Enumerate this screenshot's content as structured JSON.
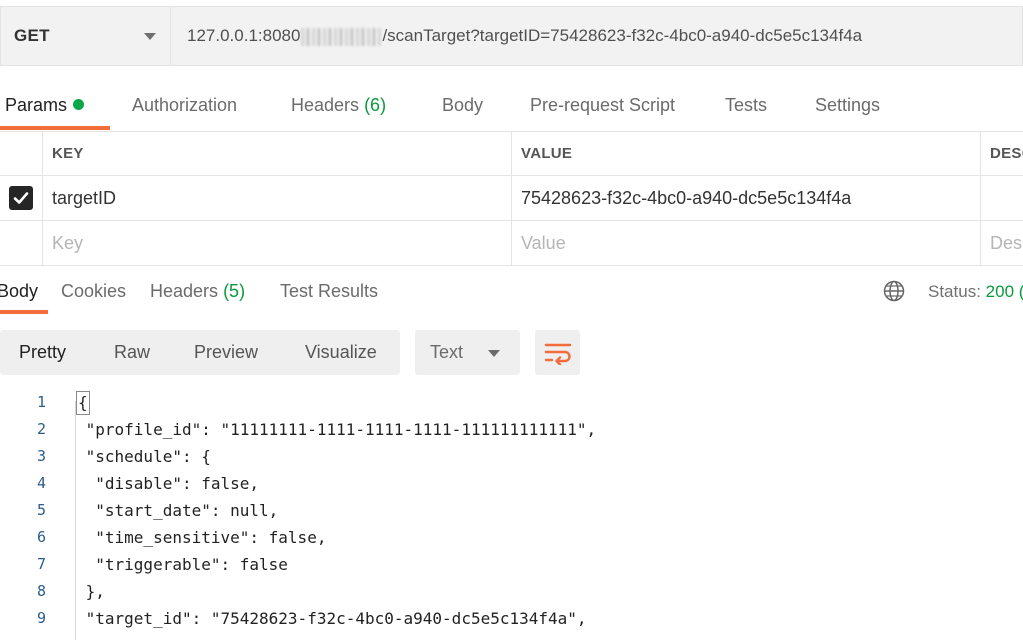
{
  "request": {
    "method": "GET",
    "url_prefix": "127.0.0.1:8080",
    "url_suffix": "/scanTarget?targetID=75428623-f32c-4bc0-a940-dc5e5c134f4a"
  },
  "request_tabs": {
    "params": "Params",
    "authorization": "Authorization",
    "headers": "Headers",
    "headers_count": "(6)",
    "body": "Body",
    "prerequest": "Pre-request Script",
    "tests": "Tests",
    "settings": "Settings"
  },
  "params_table": {
    "headers": {
      "key": "KEY",
      "value": "VALUE",
      "desc": "DESC"
    },
    "row": {
      "key": "targetID",
      "value": "75428623-f32c-4bc0-a940-dc5e5c134f4a",
      "checked": true
    },
    "placeholder": {
      "key": "Key",
      "value": "Value",
      "desc": "Des"
    }
  },
  "response_tabs": {
    "body": "Body",
    "cookies": "Cookies",
    "headers": "Headers",
    "headers_count": "(5)",
    "test_results": "Test Results"
  },
  "status": {
    "label": "Status:",
    "value": "200 ("
  },
  "view_modes": {
    "pretty": "Pretty",
    "raw": "Raw",
    "preview": "Preview",
    "visualize": "Visualize"
  },
  "format": {
    "selected": "Text"
  },
  "code_lines": [
    {
      "n": "1",
      "text": "{"
    },
    {
      "n": "2",
      "text": " \"profile_id\": \"11111111-1111-1111-1111-111111111111\","
    },
    {
      "n": "3",
      "text": " \"schedule\": {"
    },
    {
      "n": "4",
      "text": "  \"disable\": false,"
    },
    {
      "n": "5",
      "text": "  \"start_date\": null,"
    },
    {
      "n": "6",
      "text": "  \"time_sensitive\": false,"
    },
    {
      "n": "7",
      "text": "  \"triggerable\": false"
    },
    {
      "n": "8",
      "text": " },"
    },
    {
      "n": "9",
      "text": " \"target_id\": \"75428623-f32c-4bc0-a940-dc5e5c134f4a\","
    }
  ],
  "colors": {
    "accent": "#f26b3a",
    "success": "#0a9a3d"
  }
}
